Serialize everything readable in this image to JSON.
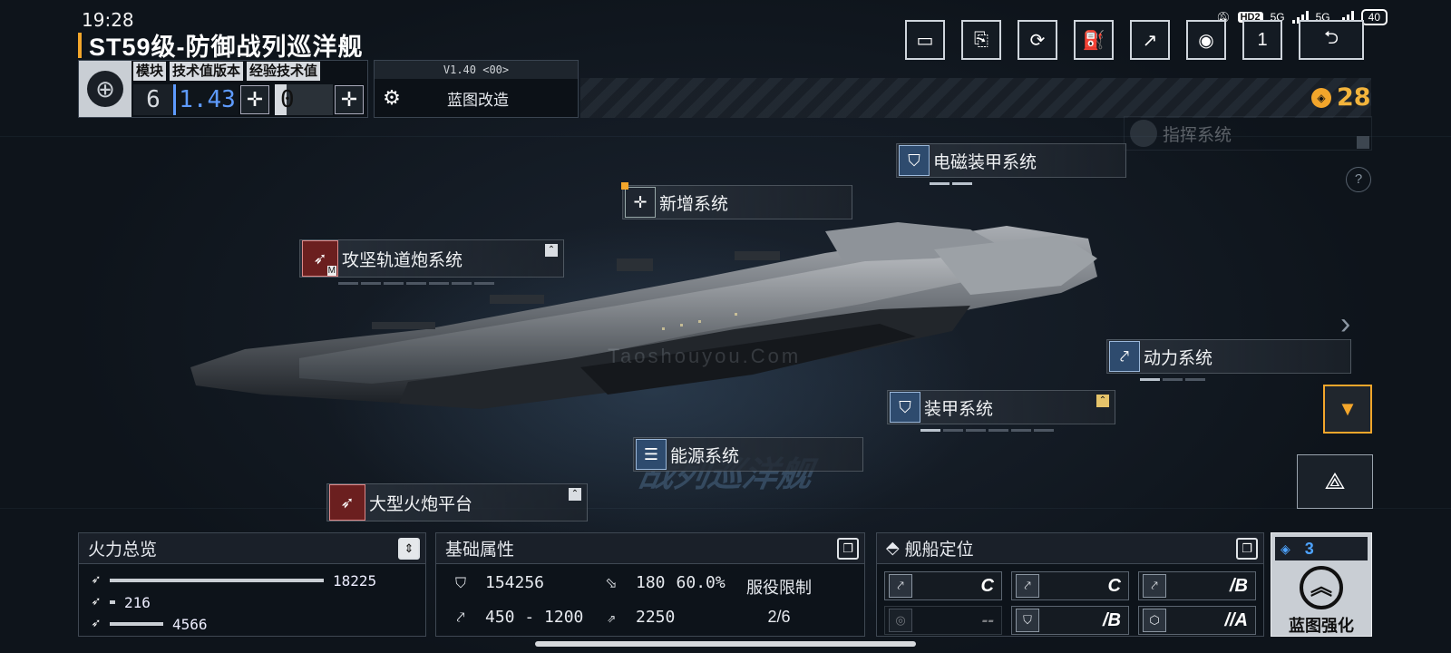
{
  "status": {
    "time": "19:28",
    "hd": "HD2",
    "net1": "5G",
    "net2": "5G",
    "battery": "40"
  },
  "header": {
    "title": "ST59级-防御战列巡洋舰"
  },
  "toolbar": {
    "buttons": [
      {
        "name": "record-button",
        "icon": "video-camera-icon",
        "glyph": "▭"
      },
      {
        "name": "blueprint-share-button",
        "icon": "blueprint-icon",
        "glyph": "⎘"
      },
      {
        "name": "refresh-button",
        "icon": "refresh-icon",
        "glyph": "⟳"
      },
      {
        "name": "paint-button",
        "icon": "paint-icon",
        "glyph": "⛽"
      },
      {
        "name": "export-button",
        "icon": "external-link-icon",
        "glyph": "↗"
      },
      {
        "name": "view-button",
        "icon": "eye-icon",
        "glyph": "◉"
      },
      {
        "name": "count-button",
        "icon": "count-icon",
        "glyph": "1"
      }
    ],
    "back_glyph": "⮌"
  },
  "info": {
    "headers": [
      "模块",
      "技术值版本",
      "经验技术值"
    ],
    "modules": "6",
    "tech_version": "1.43",
    "exp_value": "0"
  },
  "blueprint": {
    "version": "V1.40 <00>",
    "label": "蓝图改造"
  },
  "currency": {
    "value": "28"
  },
  "watermark": {
    "small": "Taoshouyou.Com",
    "big": "战列巡洋舰"
  },
  "systems": {
    "command": "指挥系统",
    "em_armor": "电磁装甲系统",
    "new_system": "新增系统",
    "railgun": "攻坚轨道炮系统",
    "railgun_badge": "M",
    "power": "动力系统",
    "armor": "装甲系统",
    "energy": "能源系统",
    "cannon": "大型火炮平台"
  },
  "firepower": {
    "title": "火力总览",
    "rows": [
      {
        "value": "18225",
        "fraction": 1.0
      },
      {
        "value": "216",
        "fraction": 0.012
      },
      {
        "value": "4566",
        "fraction": 0.25
      }
    ]
  },
  "attributes": {
    "title": "基础属性",
    "hp": "154256",
    "shield": "180",
    "shield_pct": "60.0%",
    "speed": "450 - 1200",
    "warp": "2250",
    "service_label": "服役限制",
    "service_value": "2/6"
  },
  "positioning": {
    "title": "舰船定位",
    "cells": [
      {
        "icon": "⤤",
        "value": "C",
        "dim": false
      },
      {
        "icon": "⤤",
        "value": "C",
        "dim": false
      },
      {
        "icon": "⤤",
        "value": "/B",
        "dim": false
      },
      {
        "icon": "◎",
        "value": "--",
        "dim": true
      },
      {
        "icon": "⛉",
        "value": "/B",
        "dim": false
      },
      {
        "icon": "⬡",
        "value": "//A",
        "dim": false
      }
    ]
  },
  "enhance": {
    "count": "3",
    "label": "蓝图强化"
  },
  "colors": {
    "accent": "#f3a62b",
    "blue": "#4da3ff",
    "background": "#101720"
  }
}
